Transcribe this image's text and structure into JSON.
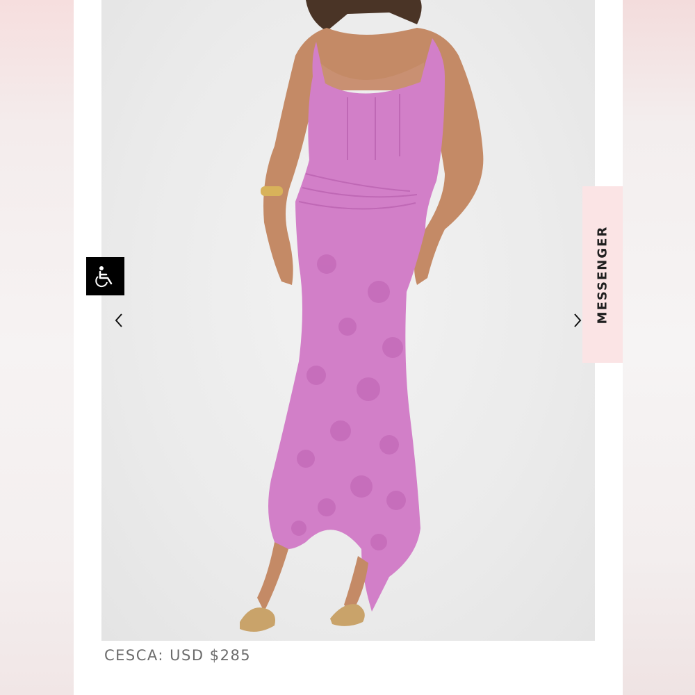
{
  "product": {
    "caption": "CESCA: USD $285",
    "dress_color": "#d27fc8",
    "dress_pattern_color": "#c46ab8"
  },
  "carousel": {
    "prev_icon": "chevron-left-icon",
    "next_icon": "chevron-right-icon"
  },
  "accessibility": {
    "icon": "wheelchair-icon"
  },
  "messenger": {
    "label": "MESSENGER",
    "background": "#fbe4e5"
  }
}
